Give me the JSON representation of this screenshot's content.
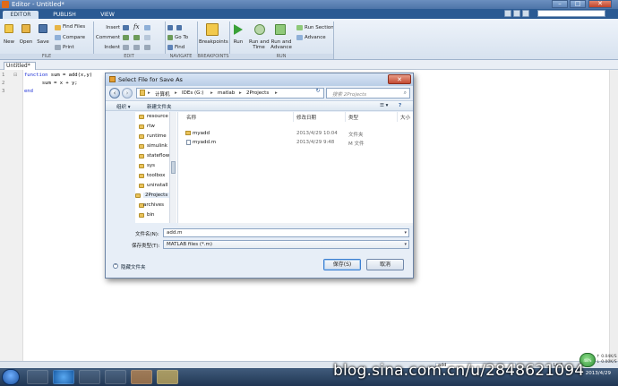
{
  "window": {
    "title": "Editor - Untitled*",
    "minimize": "–",
    "maximize": "□",
    "close": "✕"
  },
  "ribbon_tabs": [
    "EDITOR",
    "PUBLISH",
    "VIEW"
  ],
  "ribbon": {
    "file": {
      "new": "New",
      "open": "Open",
      "save": "Save",
      "find_files": "Find Files",
      "compare": "Compare",
      "print": "Print",
      "section": "FILE"
    },
    "edit": {
      "insert": "Insert",
      "comment": "Comment",
      "indent": "Indent",
      "fx": "fx",
      "section": "EDIT"
    },
    "navigate": {
      "go_to": "Go To",
      "find": "Find",
      "section": "NAVIGATE"
    },
    "breakpoints": {
      "label": "Breakpoints",
      "section": "BREAKPOINTS"
    },
    "run": {
      "run": "Run",
      "run_and_time": "Run and\nTime",
      "run_and_advance": "Run and\nAdvance",
      "run_section": "Run Section",
      "advance": "Advance",
      "section": "RUN"
    }
  },
  "editor": {
    "tab": "Untitled*",
    "lines": [
      {
        "num": "1",
        "fold": "⊟",
        "keyword": "function",
        "rest": " sum = add(x,y)"
      },
      {
        "num": "2",
        "fold": "",
        "keyword": "",
        "rest": "      sum = x + y;"
      },
      {
        "num": "3",
        "fold": "",
        "keyword": "end",
        "rest": ""
      }
    ]
  },
  "dialog": {
    "title": "Select File for Save As",
    "close": "✕",
    "breadcrumb": [
      "计算机",
      "IDEs (G:)",
      "matlab",
      "2Projects"
    ],
    "search_placeholder": "搜索 2Projects",
    "organize": "组织 ▾",
    "new_folder": "新建文件夹",
    "nav_items": [
      "resource",
      "rtw",
      "runtime",
      "simulink",
      "stateflow",
      "sys",
      "toolbox",
      "uninstall",
      "2Projects",
      "archives",
      "bin"
    ],
    "columns": {
      "name": "名称",
      "date": "修改日期",
      "type": "类型",
      "size": "大小"
    },
    "files": [
      {
        "name": "myadd",
        "date": "2013/4/29 10:04",
        "type": "文件夹",
        "kind": "folder"
      },
      {
        "name": "myadd.m",
        "date": "2013/4/29 9:48",
        "type": "M 文件",
        "kind": "file"
      }
    ],
    "filename_label": "文件名(N):",
    "filename_value": "add.m",
    "filetype_label": "保存类型(T):",
    "filetype_value": "MATLAB files (*.m)",
    "hide_folders": "隐藏文件夹",
    "save_button": "保存(S)",
    "cancel_button": "取消"
  },
  "statusbar": {
    "function_name": "add",
    "ln_label": "Ln 1"
  },
  "system": {
    "net_percent": "48%",
    "net_up": "↑ 0.04K/S",
    "net_down": "↓ 0.00K/S",
    "date": "2013/4/29"
  },
  "watermark": "blog.sina.com.cn/u/2848621094"
}
